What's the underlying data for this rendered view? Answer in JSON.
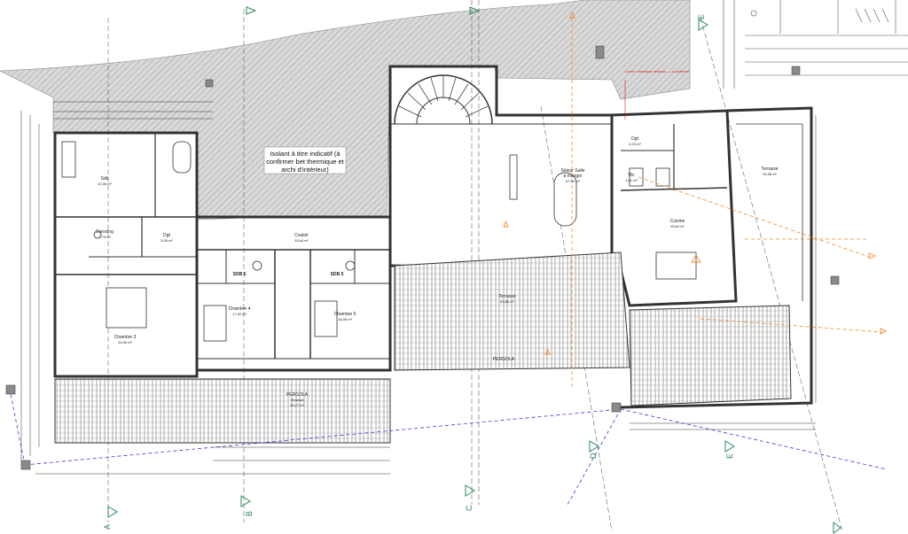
{
  "note": {
    "line1": "Isolant à titre indicatif (à",
    "line2": "confirmer bet thermique et",
    "line3": "archi d'intérieur)"
  },
  "grid_labels": {
    "A": "A",
    "B": "B",
    "C": "C",
    "D": "D",
    "E": "E"
  },
  "rooms": {
    "sdb": {
      "name": "Sdb",
      "area": "10,35 m²"
    },
    "dressing": {
      "name": "Dressing",
      "area": "7,75 m²"
    },
    "dgt_left": {
      "name": "Dgt",
      "area": "5,06 m²"
    },
    "couloir": {
      "name": "Couloir",
      "area": "33,64 m²"
    },
    "chambre3": {
      "name": "Chambre 3",
      "area": "24,06 m²"
    },
    "sdb6": {
      "name": "SDB 6"
    },
    "sdb5": {
      "name": "SDB 5"
    },
    "chambre4": {
      "name": "Chambre 4",
      "area": "17,92 m²"
    },
    "chambre5": {
      "name": "Chambre 5",
      "area": "18,05 m²"
    },
    "sejour": {
      "name": "Séjour Salle",
      "name2": "à manger",
      "area": "57,60 m²"
    },
    "dgt_right": {
      "name": "Dgt",
      "area": "4,23 m²"
    },
    "wc": {
      "name": "Wc",
      "area": "1,61 m²"
    },
    "cuisine": {
      "name": "Cuisine",
      "area": "25,64 m²"
    },
    "terrasse_right": {
      "name": "Terrasse",
      "area": "33,38 m²"
    },
    "terrasse_mid": {
      "name": "Terrasse",
      "area": "63,86 m²"
    },
    "pergola_mid": {
      "name": "PERGOLA"
    },
    "pergola_left": {
      "name": "PERGOLA",
      "sub": "Terrasse",
      "area": "45,27 m²"
    }
  }
}
